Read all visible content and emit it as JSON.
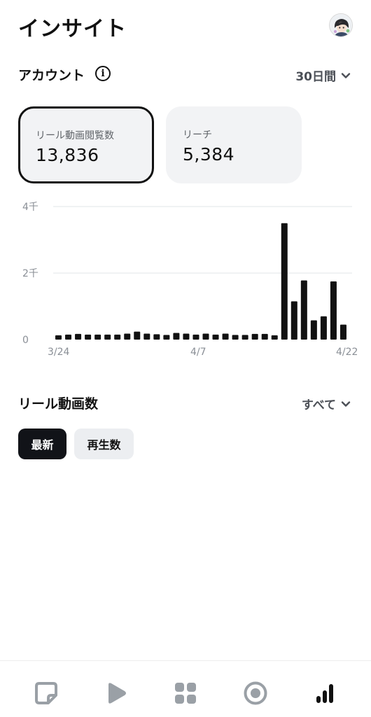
{
  "header": {
    "title": "インサイト",
    "avatar": "avatar"
  },
  "account": {
    "label": "アカウント",
    "info_icon": "info-icon",
    "range": "30日間"
  },
  "cards": [
    {
      "label": "リール動画閲覧数",
      "value": "13,836",
      "selected": true
    },
    {
      "label": "リーチ",
      "value": "5,384",
      "selected": false
    }
  ],
  "chart_data": {
    "type": "bar",
    "y_ticks": [
      "0",
      "2千",
      "4千"
    ],
    "ylim": [
      0,
      4000
    ],
    "x_ticks": [
      "3/24",
      "4/7",
      "4/22"
    ],
    "categories": [
      "3/24",
      "3/25",
      "3/26",
      "3/27",
      "3/28",
      "3/29",
      "3/30",
      "3/31",
      "4/1",
      "4/2",
      "4/3",
      "4/4",
      "4/5",
      "4/6",
      "4/7",
      "4/8",
      "4/9",
      "4/10",
      "4/11",
      "4/12",
      "4/13",
      "4/14",
      "4/15",
      "4/16",
      "4/17",
      "4/18",
      "4/19",
      "4/20",
      "4/21",
      "4/22"
    ],
    "values": [
      130,
      150,
      170,
      150,
      150,
      150,
      150,
      180,
      240,
      180,
      160,
      140,
      200,
      180,
      150,
      180,
      150,
      180,
      140,
      140,
      170,
      170,
      130,
      3500,
      1150,
      1780,
      580,
      700,
      1750,
      450
    ],
    "bar_color": "#111111",
    "grid": true
  },
  "reels": {
    "label": "リール動画数",
    "filter": "すべて",
    "chips": [
      "最新",
      "再生数"
    ]
  },
  "tabbar": {
    "items": [
      "post-icon",
      "reels-play-icon",
      "grid-icon",
      "stories-icon",
      "insights-icon"
    ],
    "active": "insights-icon"
  }
}
